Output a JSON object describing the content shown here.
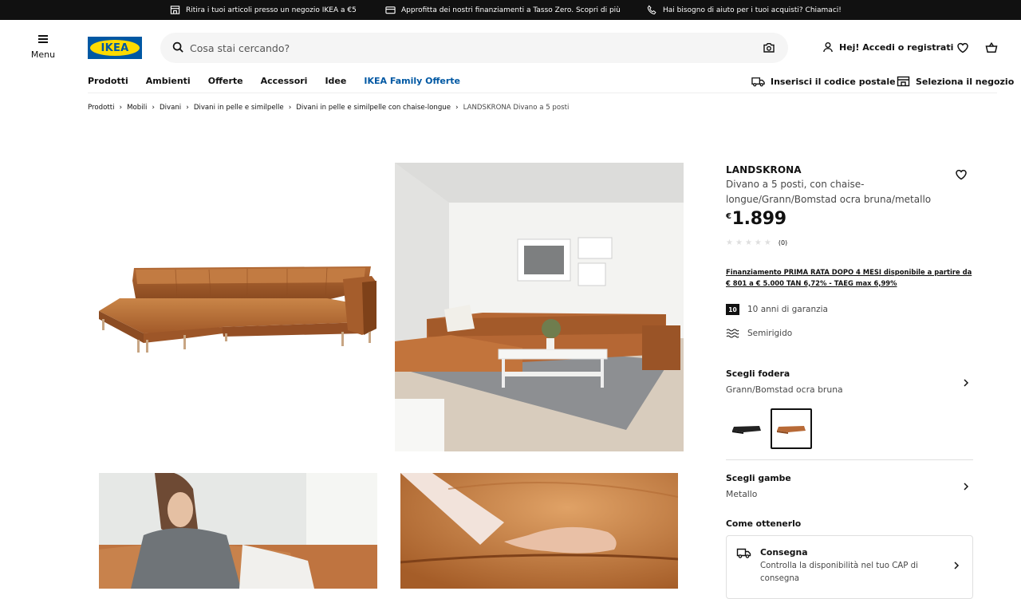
{
  "promo": [
    {
      "icon": "store-icon",
      "text": "Ritira i tuoi articoli presso un negozio IKEA a €5"
    },
    {
      "icon": "credit-card-icon",
      "text": "Approfitta dei nostri finanziamenti a Tasso Zero. Scopri di più"
    },
    {
      "icon": "phone-icon",
      "text": "Hai bisogno di aiuto per i tuoi acquisti? Chiamaci!"
    }
  ],
  "header": {
    "menu_label": "Menu",
    "logo_text": "IKEA",
    "search_placeholder": "Cosa stai cercando?",
    "login_label": "Hej! Accedi o registrati"
  },
  "nav": {
    "items": [
      "Prodotti",
      "Ambienti",
      "Offerte",
      "Accessori",
      "Idee"
    ],
    "family": "IKEA Family Offerte",
    "postcode": "Inserisci il codice postale",
    "store": "Seleziona il negozio"
  },
  "breadcrumb": [
    "Prodotti",
    "Mobili",
    "Divani",
    "Divani in pelle e similpelle",
    "Divani in pelle e similpelle con chaise-longue",
    "LANDSKRONA Divano a 5 posti"
  ],
  "product": {
    "name": "LANDSKRONA",
    "description": "Divano a 5 posti, con chaise-longue/Grann/Bomstad ocra bruna/metallo",
    "currency": "€",
    "price": "1.899",
    "rating": 0,
    "rating_max": 5,
    "review_count": "(0)",
    "financing": "Finanziamento PRIMA RATA DOPO 4 MESI disponibile a partire da € 801 a € 5.000 TAN 6,72% - TAEG max 6,99%",
    "warranty_badge": "10",
    "warranty": "10 anni di garanzia",
    "firmness": "Semirigido"
  },
  "options": {
    "cover_title": "Scegli fodera",
    "cover_value": "Grann/Bomstad ocra bruna",
    "legs_title": "Scegli gambe",
    "legs_value": "Metallo",
    "how_title": "Come ottenerlo",
    "delivery_title": "Consegna",
    "delivery_text": "Controlla la disponibilità nel tuo CAP di consegna"
  },
  "colors": {
    "brand_blue": "#0058a3",
    "brand_yellow": "#ffdb00",
    "leather": "#b86a37"
  }
}
